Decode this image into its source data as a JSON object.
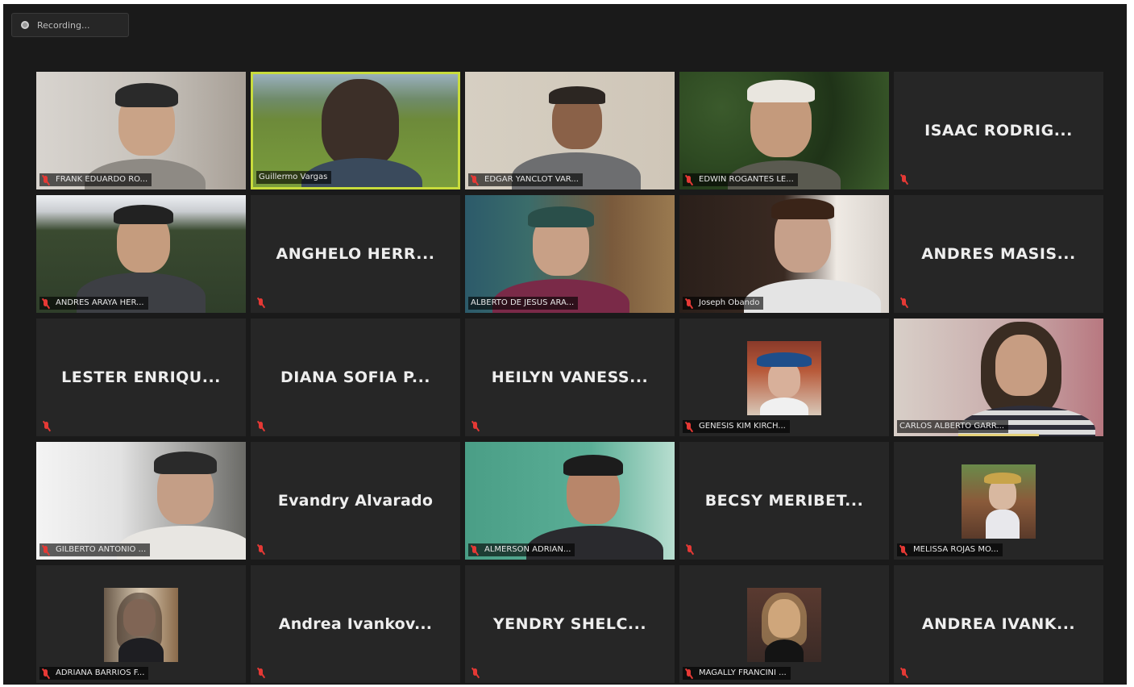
{
  "recording": {
    "label": "Recording..."
  },
  "participants": [
    {
      "name": "FRANK EDUARDO RO...",
      "video": true
    },
    {
      "name": "Guillermo Vargas",
      "video": true,
      "active_speaker": true
    },
    {
      "name": "EDGAR YANCLOT VAR...",
      "video": true
    },
    {
      "name": "EDWIN ROGANTES LE...",
      "video": true
    },
    {
      "name": "ISAAC RODRIG...",
      "video": false
    },
    {
      "name": "ANDRES ARAYA HER...",
      "video": true
    },
    {
      "name": "ANGHELO HERR...",
      "video": false
    },
    {
      "name": "ALBERTO DE JESUS ARA...",
      "video": true
    },
    {
      "name": "Joseph Obando",
      "video": true
    },
    {
      "name": "ANDRES MASIS...",
      "video": false
    },
    {
      "name": "LESTER ENRIQU...",
      "video": false
    },
    {
      "name": "DIANA SOFIA P...",
      "video": false
    },
    {
      "name": "HEILYN VANESS...",
      "video": false
    },
    {
      "name": "GENESIS KIM KIRCH...",
      "video": false,
      "photo": true
    },
    {
      "name": "CARLOS ALBERTO GARR...",
      "video": true
    },
    {
      "name": "GILBERTO ANTONIO ...",
      "video": true
    },
    {
      "name": "Evandry Alvarado",
      "video": false
    },
    {
      "name": "ALMERSON ADRIAN...",
      "video": true
    },
    {
      "name": "BECSY MERIBET...",
      "video": false
    },
    {
      "name": "MELISSA ROJAS MO...",
      "video": false,
      "photo": true
    },
    {
      "name": "ADRIANA BARRIOS F...",
      "video": false,
      "photo": true
    },
    {
      "name": "Andrea Ivankov...",
      "video": false
    },
    {
      "name": "YENDRY SHELC...",
      "video": false
    },
    {
      "name": "MAGALLY FRANCINI ...",
      "video": false,
      "photo": true
    },
    {
      "name": "ANDREA IVANK...",
      "video": false
    }
  ],
  "colors": {
    "window_bg": "#1a1a1a",
    "tile_bg": "#262626",
    "active_speaker_border": "#c8dc3c",
    "muted_icon": "#e53935"
  }
}
